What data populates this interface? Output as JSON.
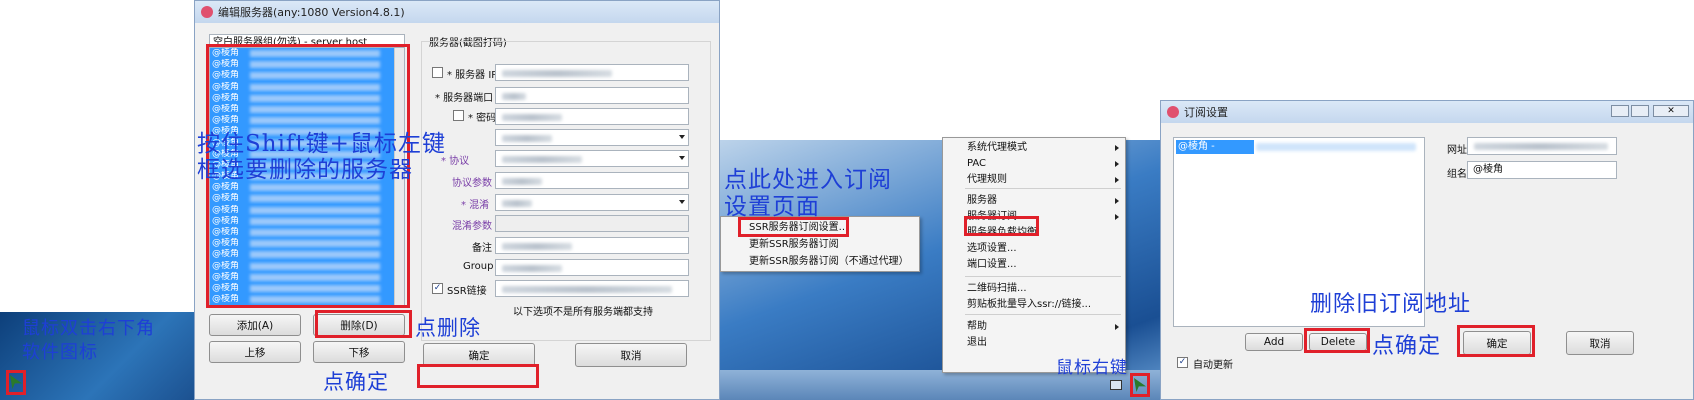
{
  "panel1": {
    "window_title": "编辑服务器(any:1080 Version4.8.1)",
    "group_dropdown": "空白服务器组(勿选) - server host",
    "server_list_prefix": "@棱角",
    "server_list_count": 23,
    "buttons": {
      "add": "添加(A)",
      "delete": "删除(D)",
      "move_up": "上移",
      "move_down": "下移",
      "ok": "确定",
      "cancel": "取消"
    },
    "group_title": "服务器(截图打码)",
    "labels": {
      "ip": "* 服务器 IP",
      "port": "* 服务器端口",
      "password": "* 密码",
      "protocol": "* 协议",
      "protocol_param": "协议参数",
      "obfs": "* 混淆",
      "obfs_param": "混淆参数",
      "remark": "备注",
      "group": "Group",
      "ssr_link": "SSR链接"
    },
    "footnote": "以下选项不是所有服务端都支持",
    "annotations": {
      "select_hint_line1": "按住Shift键+鼠标左键",
      "select_hint_line2": "框选要删除的服务器",
      "click_delete": "点删除",
      "click_ok": "点确定",
      "double_click_line1": "鼠标双击右下角",
      "double_click_line2": "软件图标"
    }
  },
  "panel2": {
    "annotation_line1": "点此处进入订阅",
    "annotation_line2": "设置页面",
    "right_click_hint": "鼠标右键",
    "submenu": [
      "SSR服务器订阅设置...",
      "更新SSR服务器订阅",
      "更新SSR服务器订阅（不通过代理）"
    ],
    "context_menu": [
      {
        "label": "系统代理模式",
        "arrow": true
      },
      {
        "label": "PAC",
        "arrow": true
      },
      {
        "label": "代理规则",
        "arrow": true
      },
      {
        "label": "服务器",
        "arrow": true
      },
      {
        "label": "服务器订阅",
        "arrow": true
      },
      {
        "label": "服务器负载均衡",
        "arrow": false
      },
      {
        "label": "选项设置...",
        "arrow": false
      },
      {
        "label": "端口设置...",
        "arrow": false
      },
      {
        "label": "二维码扫描...",
        "arrow": false
      },
      {
        "label": "剪贴板批量导入ssr://链接...",
        "arrow": false
      },
      {
        "label": "帮助",
        "arrow": true
      },
      {
        "label": "退出",
        "arrow": false
      }
    ]
  },
  "panel3": {
    "window_title": "订阅设置",
    "list_item": "@棱角 -",
    "url_label": "网址",
    "group_label": "组名",
    "group_value": "@棱角",
    "buttons": {
      "add": "Add",
      "delete": "Delete",
      "ok": "确定",
      "cancel": "取消"
    },
    "auto_update": "自动更新",
    "annotations": {
      "delete_old": "删除旧订阅地址",
      "click_ok": "点确定"
    }
  },
  "colors": {
    "annotation": "#1e3fd6",
    "highlight": "#e0202a",
    "selection": "#3399ff"
  }
}
